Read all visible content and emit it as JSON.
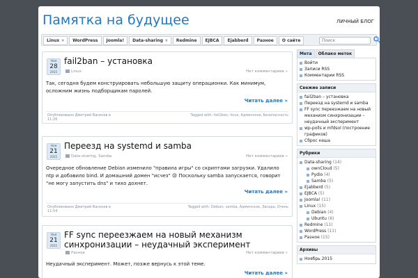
{
  "site": {
    "title": "Памятка на будущее",
    "tagline": "ЛИЧНЫЙ БЛОГ"
  },
  "nav": {
    "items": [
      "Linux",
      "WordPress",
      "Joomla!",
      "Data-sharing",
      "Redmine",
      "EJBCA",
      "Ejabberd",
      "Разное",
      "О сайте"
    ],
    "search_placeholder": "Поиск"
  },
  "posts": [
    {
      "date": {
        "month": "Ноя",
        "day": "28",
        "year": "2015"
      },
      "title": "fail2ban – установка",
      "category": "Linux",
      "comments": "Нет комментариев »",
      "body": "Так, сегодня будем конструировать небольшую защиту операционки. Как минимум, осложним жизнь подборщикам паролей.",
      "more": "Читать далее »",
      "author": "Опубликовано Дмитрий Васенев в 11:26",
      "tags": "Tagged with: fail2ban, linux, Админское, Безопасность"
    },
    {
      "date": {
        "month": "Ноя",
        "day": "21",
        "year": "2015"
      },
      "title": "Переезд на systemd и samba",
      "category": "Data-sharing, Samba",
      "comments": "Нет комментариев »",
      "body": "Очередное обновление Debian изменило \"правила игры\" со скриптами загрузки. Удалило ntp и добавило bind. И домашний домен \"исчез\" 😢 Поскольку samba запускается, говорит \"не могу запустить dns\" и тихо дохнет.",
      "more": "Читать далее »",
      "author": "Опубликовано Дмитрий Васенев в 11:54",
      "tags": "Tagged with: Debian, samba, Админское, Засада, Очень"
    },
    {
      "date": {
        "month": "Ноя",
        "day": "21",
        "year": "2015"
      },
      "title": "FF sync переезжаем на новый механизм синхронизации – неудачный эксперимент",
      "category": "Разное",
      "comments": "Нет комментариев »",
      "body": "Неудачный эксперимент. Может, позже вернусь к этой теме.",
      "more": "Читать далее »"
    }
  ],
  "sidebar": {
    "tabs": [
      "Мета",
      "Облако меток"
    ],
    "meta": [
      "Войти",
      "Записи RSS",
      "Комментарии RSS"
    ],
    "recent_title": "Свежие записи",
    "recent": [
      "fail2ban – установка",
      "Переезд на systemd и samba",
      "FF sync переезжаем на новый механизм синхронизации – неудачный эксперимент",
      "wp-polls и mfdsol (построение графиков)",
      "Сброс кеша"
    ],
    "rubrics_title": "Рубрики",
    "rubrics": [
      {
        "name": "Data-sharing",
        "count": "(14)",
        "sub": false
      },
      {
        "name": "ownCloud",
        "count": "(5)",
        "sub": true
      },
      {
        "name": "Pydio",
        "count": "(4)",
        "sub": true
      },
      {
        "name": "Samba",
        "count": "(5)",
        "sub": true
      },
      {
        "name": "Ejabberd",
        "count": "(5)",
        "sub": false
      },
      {
        "name": "EJBCA",
        "count": "(5)",
        "sub": false
      },
      {
        "name": "Joomla!",
        "count": "(11)",
        "sub": false
      },
      {
        "name": "Linux",
        "count": "(15)",
        "sub": false
      },
      {
        "name": "Debian",
        "count": "(4)",
        "sub": true
      },
      {
        "name": "Ubuntu",
        "count": "(6)",
        "sub": true
      },
      {
        "name": "Redmine",
        "count": "(11)",
        "sub": false
      },
      {
        "name": "WordPress",
        "count": "(11)",
        "sub": false
      },
      {
        "name": "Разное",
        "count": "(15)",
        "sub": false
      }
    ],
    "archive_title": "Архивы",
    "archive": [
      "Ноябрь 2015"
    ]
  }
}
